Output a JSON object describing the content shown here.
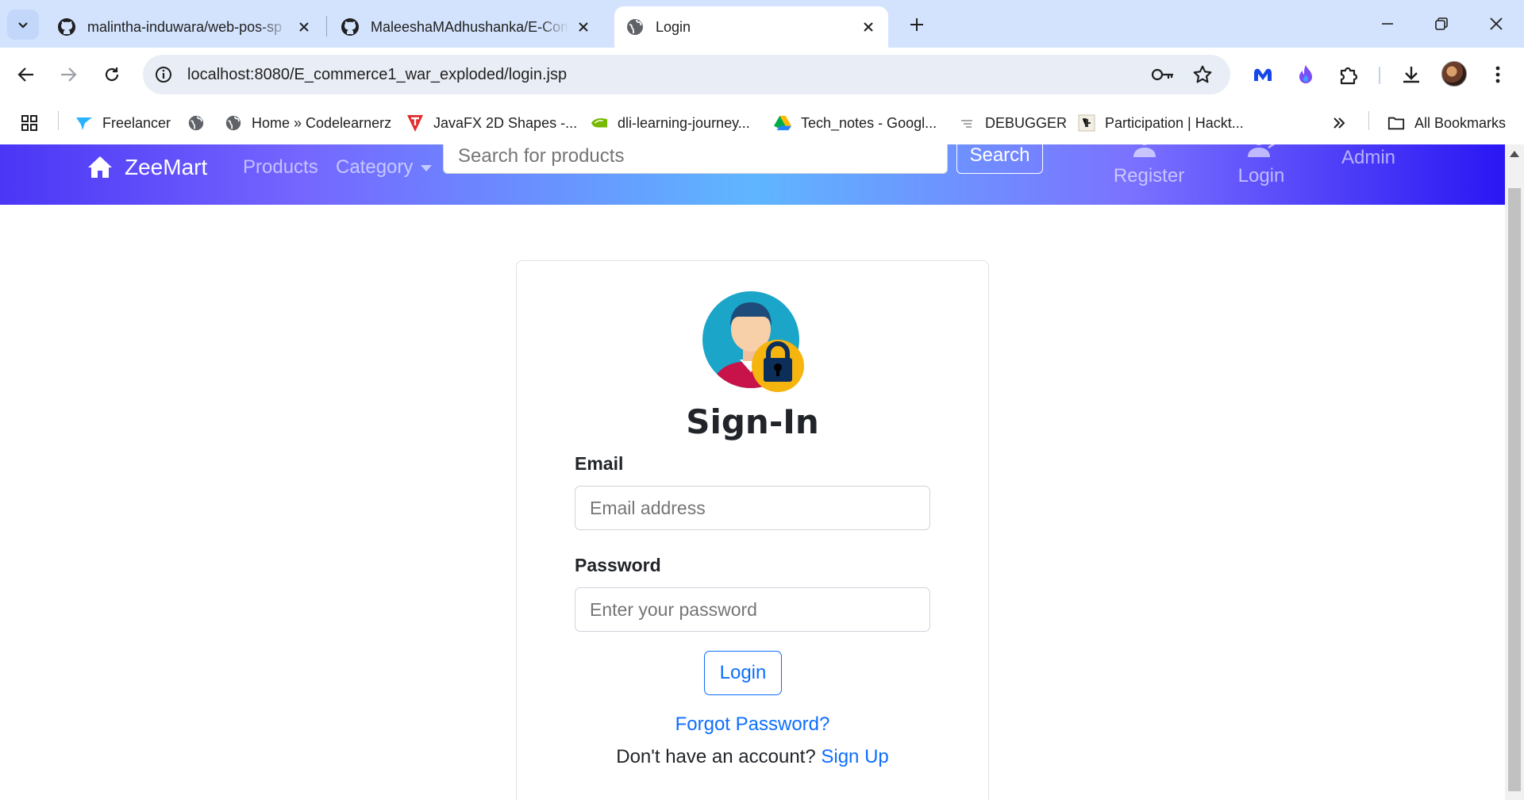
{
  "browser": {
    "tabs": [
      {
        "title": "malintha-induwara/web-pos-sp",
        "active": false
      },
      {
        "title": "MaleeshaMAdhushanka/E-Com",
        "active": false
      },
      {
        "title": "Login",
        "active": true
      }
    ],
    "url": "localhost:8080/E_commerce1_war_exploded/login.jsp",
    "bookmarks": [
      "Freelancer",
      "",
      "Home » Codelearnerz",
      "JavaFX 2D Shapes -...",
      "dli-learning-journey...",
      "Tech_notes - Googl...",
      "DEBUGGER",
      "Participation | Hackt..."
    ],
    "all_bookmarks": "All Bookmarks"
  },
  "site_nav": {
    "brand": "ZeeMart",
    "products": "Products",
    "category": "Category",
    "search_placeholder": "Search for products",
    "search_button": "Search",
    "register": "Register",
    "login": "Login",
    "admin": "Admin",
    "accent": "#4a36f5"
  },
  "login_card": {
    "title": "Sign-In",
    "email_label": "Email",
    "email_placeholder": "Email address",
    "password_label": "Password",
    "password_placeholder": "Enter your password",
    "login_button": "Login",
    "forgot": "Forgot Password?",
    "no_account": "Don't have an account?",
    "sign_up": "Sign Up",
    "link_color": "#0d6efd"
  }
}
